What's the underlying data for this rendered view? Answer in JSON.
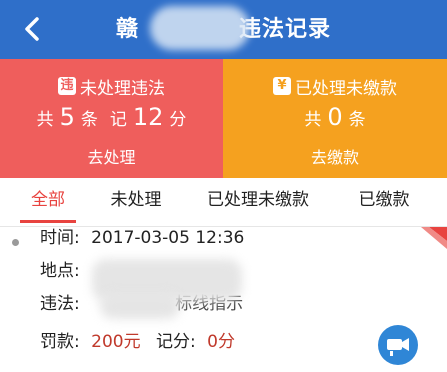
{
  "header": {
    "title_left": "赣",
    "title_right": "违法记录"
  },
  "unprocessed": {
    "badge": "违",
    "label": "未处理违法",
    "prefix": "共",
    "count": "5",
    "count_unit": "条",
    "points_prefix": "记",
    "points": "12",
    "points_unit": "分",
    "action": "去处理"
  },
  "unpaid": {
    "badge": "¥",
    "label": "已处理未缴款",
    "prefix": "共",
    "count": "0",
    "count_unit": "条",
    "action": "去缴款"
  },
  "tabs": [
    {
      "label": "全部",
      "active": true
    },
    {
      "label": "未处理",
      "active": false
    },
    {
      "label": "已处理未缴款",
      "active": false
    },
    {
      "label": "已缴款",
      "active": false
    }
  ],
  "record": {
    "time_label": "时间:",
    "time_value": "2017-03-05 12:36",
    "location_label": "地点:",
    "violation_label": "违法:",
    "violation_value": "标线指示",
    "fine_label": "罚款:",
    "fine_value": "200元",
    "points_label": "记分:",
    "points_value": "0分"
  },
  "colors": {
    "header": "#2f6fc9",
    "unprocessed": "#ef5e5c",
    "unpaid": "#f5a11f",
    "active_tab": "#e8433f",
    "fab": "#2f86d6"
  },
  "icons": {
    "back": "chevron-left-icon",
    "fab": "camera-icon"
  }
}
